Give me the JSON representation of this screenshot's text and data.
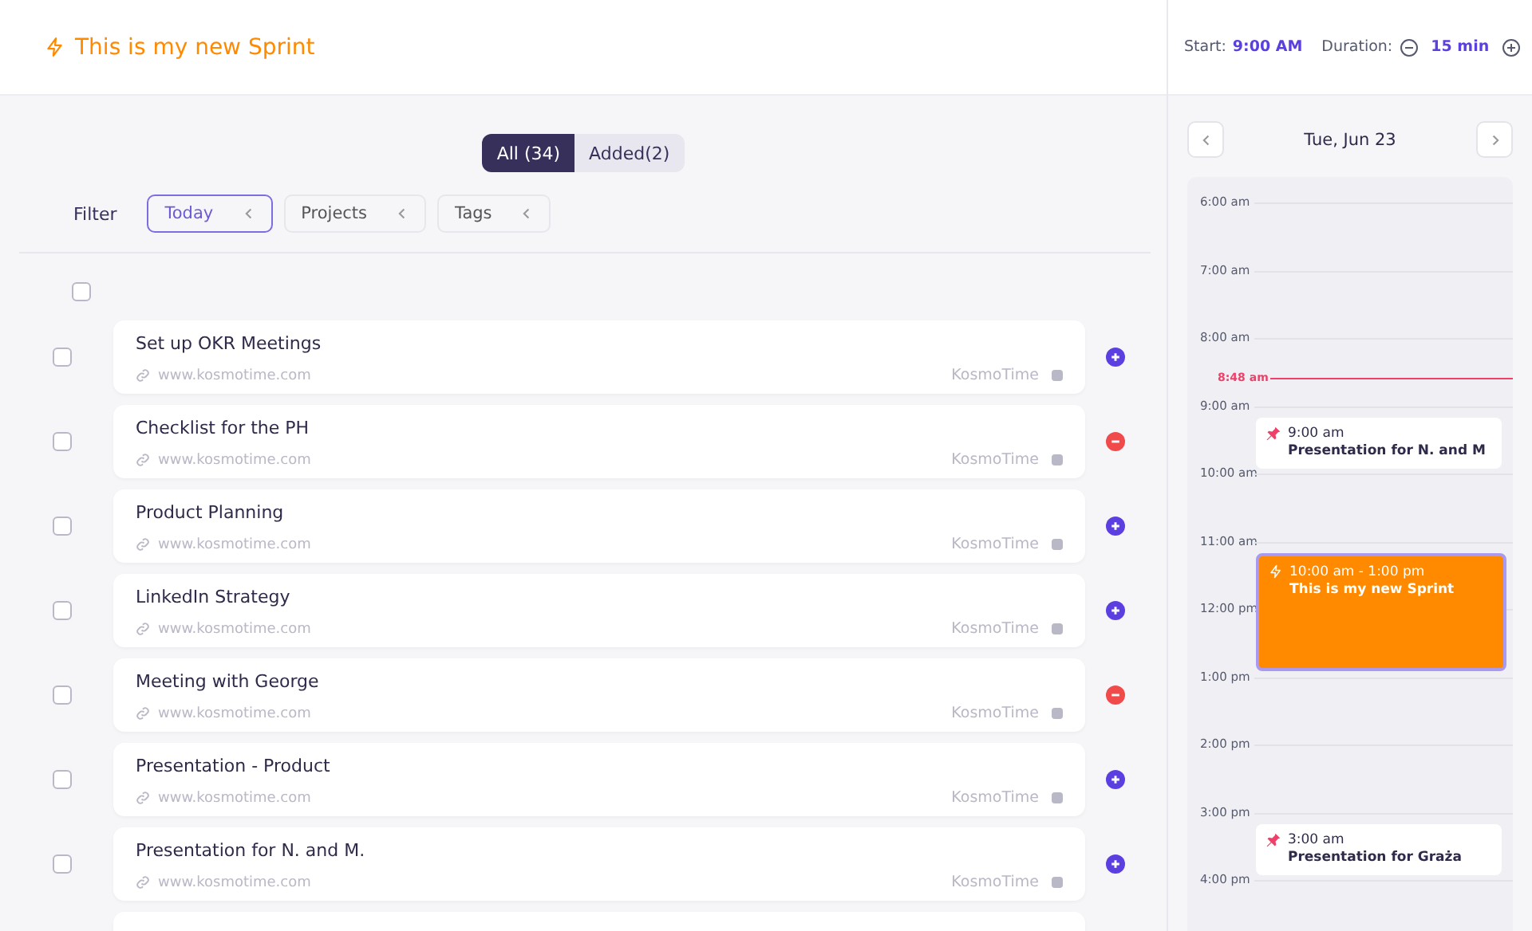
{
  "sprint": {
    "title": "This is my new Sprint"
  },
  "segments": [
    {
      "label": "All (34)",
      "selected": true
    },
    {
      "label": "Added(2)",
      "selected": false
    }
  ],
  "filter": {
    "label": "Filter",
    "chips": [
      {
        "label": "Today",
        "selected": true
      },
      {
        "label": "Projects",
        "selected": false
      },
      {
        "label": "Tags",
        "selected": false
      }
    ]
  },
  "select_all": {
    "checked": false
  },
  "tasks": [
    {
      "title": "Set up OKR Meetings",
      "url": "www.kosmotime.com",
      "source": "KosmoTime",
      "checked": false,
      "added": false
    },
    {
      "title": "Checklist for the PH",
      "url": "www.kosmotime.com",
      "source": "KosmoTime",
      "checked": false,
      "added": true
    },
    {
      "title": "Product Planning",
      "url": "www.kosmotime.com",
      "source": "KosmoTime",
      "checked": false,
      "added": false
    },
    {
      "title": "LinkedIn Strategy",
      "url": "www.kosmotime.com",
      "source": "KosmoTime",
      "checked": false,
      "added": false
    },
    {
      "title": "Meeting with George",
      "url": "www.kosmotime.com",
      "source": "KosmoTime",
      "checked": false,
      "added": true
    },
    {
      "title": "Presentation - Product",
      "url": "www.kosmotime.com",
      "source": "KosmoTime",
      "checked": false,
      "added": false
    },
    {
      "title": "Presentation for N. and M.",
      "url": "www.kosmotime.com",
      "source": "KosmoTime",
      "checked": false,
      "added": false
    }
  ],
  "settings": {
    "start_label": "Start:",
    "start": "9:00 AM",
    "duration_label": "Duration:",
    "duration": "15 min"
  },
  "calendar": {
    "date": "Tue, Jun 23",
    "hours": [
      "6:00 am",
      "7:00 am",
      "8:00 am",
      "9:00 am",
      "10:00 am",
      "11:00 am",
      "12:00 pm",
      "1:00 pm",
      "2:00 pm",
      "3:00 pm",
      "4:00 pm"
    ],
    "now": "8:48 am",
    "events": [
      {
        "kind": "pinned",
        "time": "9:00 am",
        "title": "Presentation for N. and M"
      },
      {
        "kind": "sprint",
        "time": "10:00 am - 1:00 pm",
        "title": "This is my new Sprint"
      },
      {
        "kind": "pinned",
        "time": "3:00 am",
        "title": "Presentation for Graża"
      }
    ]
  }
}
